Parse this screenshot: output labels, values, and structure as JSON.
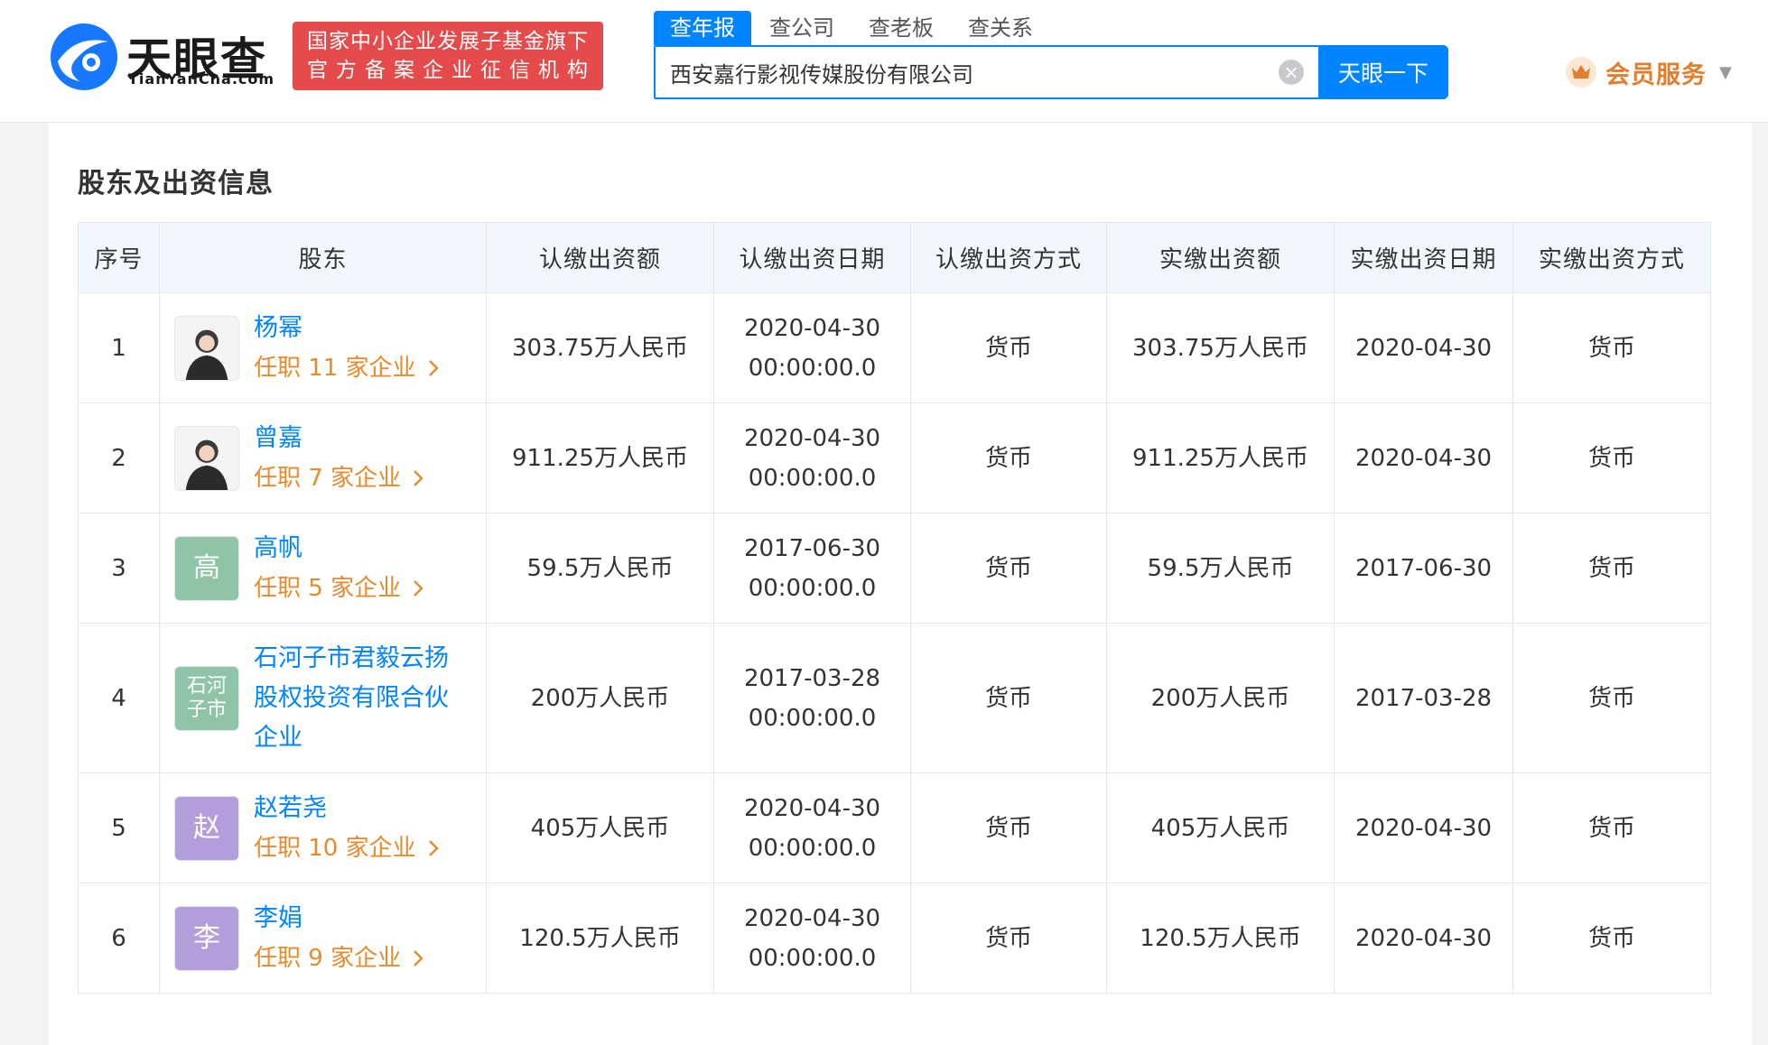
{
  "header": {
    "logo_cn": "天眼查",
    "logo_en": "TianYanCha.com",
    "badge_line1": "国家中小企业发展子基金旗下",
    "badge_line2": "官方备案企业征信机构",
    "search_tabs": [
      "查年报",
      "查公司",
      "查老板",
      "查关系"
    ],
    "search_value": "西安嘉行影视传媒股份有限公司",
    "search_button": "天眼一下",
    "vip_label": "会员服务"
  },
  "section": {
    "title": "股东及出资信息",
    "columns": [
      "序号",
      "股东",
      "认缴出资额",
      "认缴出资日期",
      "认缴出资方式",
      "实缴出资额",
      "实缴出资日期",
      "实缴出资方式"
    ]
  },
  "rows": [
    {
      "no": "1",
      "name": "杨幂",
      "posts": "任职 11 家企业",
      "sub_amount": "303.75万人民币",
      "sub_date": "2020-04-30",
      "sub_time": "00:00:00.0",
      "sub_method": "货币",
      "paid_amount": "303.75万人民币",
      "paid_date": "2020-04-30",
      "paid_method": "货币",
      "avatar_color": "#d9d9d9",
      "avatar_text": ""
    },
    {
      "no": "2",
      "name": "曾嘉",
      "posts": "任职 7 家企业",
      "sub_amount": "911.25万人民币",
      "sub_date": "2020-04-30",
      "sub_time": "00:00:00.0",
      "sub_method": "货币",
      "paid_amount": "911.25万人民币",
      "paid_date": "2020-04-30",
      "paid_method": "货币",
      "avatar_color": "#eeeeee",
      "avatar_text": ""
    },
    {
      "no": "3",
      "name": "高帆",
      "posts": "任职 5 家企业",
      "sub_amount": "59.5万人民币",
      "sub_date": "2017-06-30",
      "sub_time": "00:00:00.0",
      "sub_method": "货币",
      "paid_amount": "59.5万人民币",
      "paid_date": "2017-06-30",
      "paid_method": "货币",
      "avatar_color": "#8fc5a6",
      "avatar_text": "高"
    },
    {
      "no": "4",
      "name": "石河子市君毅云扬股权投资有限合伙企业",
      "posts": "",
      "sub_amount": "200万人民币",
      "sub_date": "2017-03-28",
      "sub_time": "00:00:00.0",
      "sub_method": "货币",
      "paid_amount": "200万人民币",
      "paid_date": "2017-03-28",
      "paid_method": "货币",
      "avatar_color": "#8fc5a6",
      "avatar_text": "石河子市"
    },
    {
      "no": "5",
      "name": "赵若尧",
      "posts": "任职 10 家企业",
      "sub_amount": "405万人民币",
      "sub_date": "2020-04-30",
      "sub_time": "00:00:00.0",
      "sub_method": "货币",
      "paid_amount": "405万人民币",
      "paid_date": "2020-04-30",
      "paid_method": "货币",
      "avatar_color": "#b39ddb",
      "avatar_text": "赵"
    },
    {
      "no": "6",
      "name": "李娟",
      "posts": "任职 9 家企业",
      "sub_amount": "120.5万人民币",
      "sub_date": "2020-04-30",
      "sub_time": "00:00:00.0",
      "sub_method": "货币",
      "paid_amount": "120.5万人民币",
      "paid_date": "2020-04-30",
      "paid_method": "货币",
      "avatar_color": "#b39ddb",
      "avatar_text": "李"
    }
  ],
  "colors": {
    "accent": "#0084ff",
    "badge": "#e64b4b",
    "posts": "#e68a2e",
    "vip": "#e17f2f"
  },
  "icons": {
    "logo": "tianyancha-eye-icon",
    "clear": "clear-icon",
    "vip": "crown-icon",
    "caret": "caret-down-icon",
    "posts_arrow": "chevron-right-icon"
  }
}
